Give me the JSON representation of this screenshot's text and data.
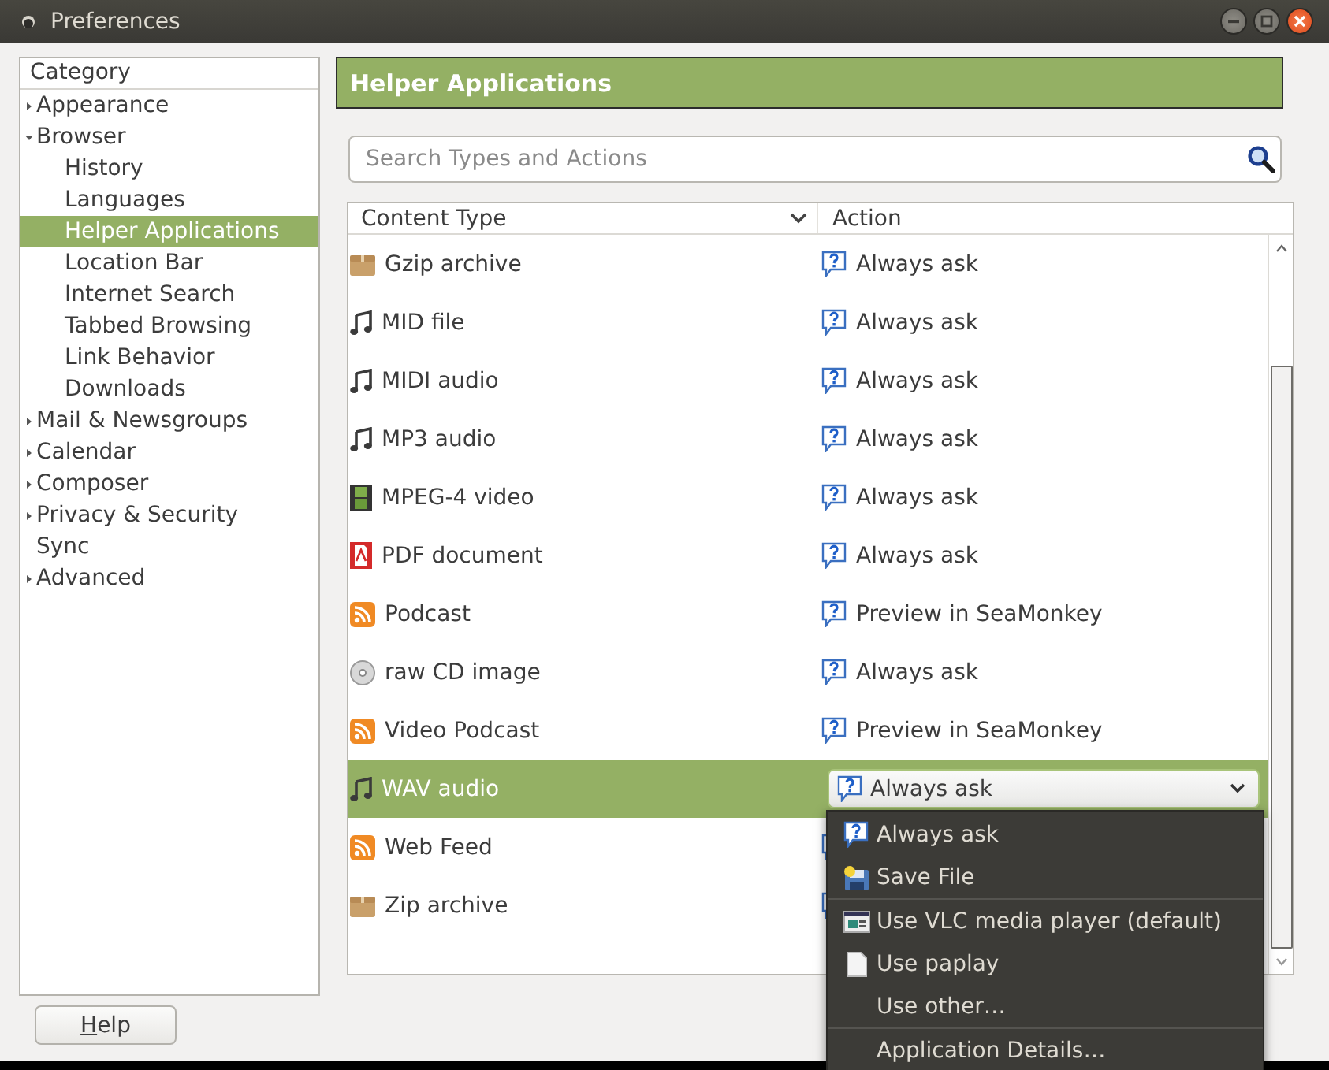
{
  "window": {
    "title": "Preferences"
  },
  "sidebar": {
    "heading": "Category",
    "items": [
      {
        "label": "Appearance",
        "expanded": false,
        "selected": false
      },
      {
        "label": "Browser",
        "expanded": true,
        "selected": false,
        "children": [
          {
            "label": "History",
            "selected": false
          },
          {
            "label": "Languages",
            "selected": false
          },
          {
            "label": "Helper Applications",
            "selected": true
          },
          {
            "label": "Location Bar",
            "selected": false
          },
          {
            "label": "Internet Search",
            "selected": false
          },
          {
            "label": "Tabbed Browsing",
            "selected": false
          },
          {
            "label": "Link Behavior",
            "selected": false
          },
          {
            "label": "Downloads",
            "selected": false
          }
        ]
      },
      {
        "label": "Mail & Newsgroups",
        "expanded": false,
        "selected": false
      },
      {
        "label": "Calendar",
        "expanded": false,
        "selected": false
      },
      {
        "label": "Composer",
        "expanded": false,
        "selected": false
      },
      {
        "label": "Privacy & Security",
        "expanded": false,
        "selected": false
      },
      {
        "label": "Sync",
        "selected": false
      },
      {
        "label": "Advanced",
        "expanded": false,
        "selected": false
      }
    ]
  },
  "panel": {
    "title": "Helper Applications",
    "search": {
      "placeholder": "Search Types and Actions"
    },
    "table": {
      "columns": [
        "Content Type",
        "Action"
      ],
      "rows": [
        {
          "type": "Gzip archive",
          "kind": "archive",
          "action": "Always ask",
          "selected": false
        },
        {
          "type": "MID file",
          "kind": "music",
          "action": "Always ask",
          "selected": false
        },
        {
          "type": "MIDI audio",
          "kind": "music",
          "action": "Always ask",
          "selected": false
        },
        {
          "type": "MP3 audio",
          "kind": "music",
          "action": "Always ask",
          "selected": false
        },
        {
          "type": "MPEG-4 video",
          "kind": "video",
          "action": "Always ask",
          "selected": false
        },
        {
          "type": "PDF document",
          "kind": "pdf",
          "action": "Always ask",
          "selected": false
        },
        {
          "type": "Podcast",
          "kind": "feed",
          "action": "Preview in SeaMonkey",
          "selected": false
        },
        {
          "type": "raw CD image",
          "kind": "disc",
          "action": "Always ask",
          "selected": false
        },
        {
          "type": "Video Podcast",
          "kind": "feed",
          "action": "Preview in SeaMonkey",
          "selected": false
        },
        {
          "type": "WAV audio",
          "kind": "music",
          "action": "Always ask",
          "selected": true
        },
        {
          "type": "Web Feed",
          "kind": "feed",
          "selected": false
        },
        {
          "type": "Zip archive",
          "kind": "archive",
          "selected": false
        }
      ]
    }
  },
  "action_menu": {
    "groups": [
      {
        "items": [
          {
            "label": "Always ask",
            "kind": "ask"
          },
          {
            "label": "Save File",
            "kind": "save"
          }
        ]
      },
      {
        "items": [
          {
            "label": "Use VLC media player (default)",
            "kind": "app"
          },
          {
            "label": "Use paplay",
            "kind": "page"
          },
          {
            "label": "Use other…",
            "kind": "plain"
          }
        ]
      },
      {
        "items": [
          {
            "label": "Application Details…",
            "kind": "plain"
          }
        ]
      }
    ]
  },
  "buttons": [
    {
      "label": "Help"
    }
  ]
}
